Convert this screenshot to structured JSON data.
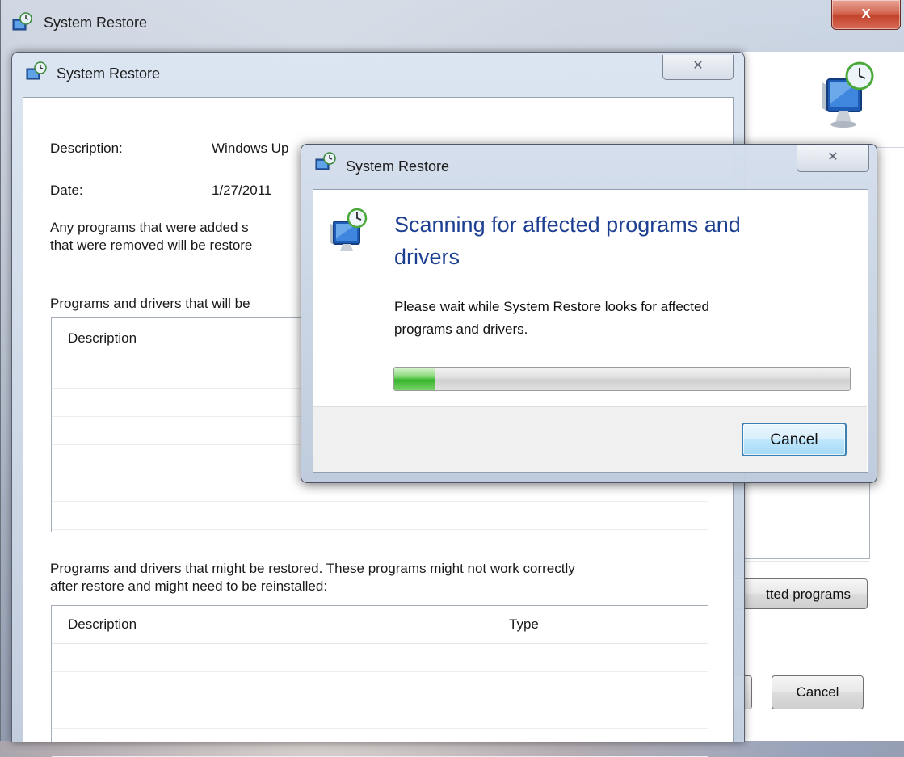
{
  "outer_window": {
    "title": "System Restore",
    "close_glyph": "x",
    "scan_button_label": "tted programs",
    "cancel_label": "Cancel"
  },
  "middle_window": {
    "title": "System Restore",
    "close_glyph": "✕",
    "description_label": "Description:",
    "description_value": "Windows Up",
    "date_label": "Date:",
    "date_value": "1/27/2011",
    "info_line1": "Any programs that were added s",
    "info_line2": "that were removed will be restore",
    "deleted_heading": "Programs and drivers that will be",
    "deleted_table": {
      "col_description": "Description",
      "col_type": ""
    },
    "restored_heading_line1": "Programs and drivers that might be restored. These programs might not work correctly",
    "restored_heading_line2": "after restore and might need to be reinstalled:",
    "restored_table": {
      "col_description": "Description",
      "col_type": "Type"
    }
  },
  "dialog": {
    "title": "System Restore",
    "close_glyph": "✕",
    "heading_line1": "Scanning for affected programs and",
    "heading_line2": "drivers",
    "body_line1": "Please wait while System Restore looks for affected",
    "body_line2": "programs and drivers.",
    "progress_fraction": 0.09,
    "cancel_label": "Cancel"
  },
  "icons": {
    "window_icon": "system-restore-icon",
    "header_icon": "system-restore-monitor-icon"
  }
}
